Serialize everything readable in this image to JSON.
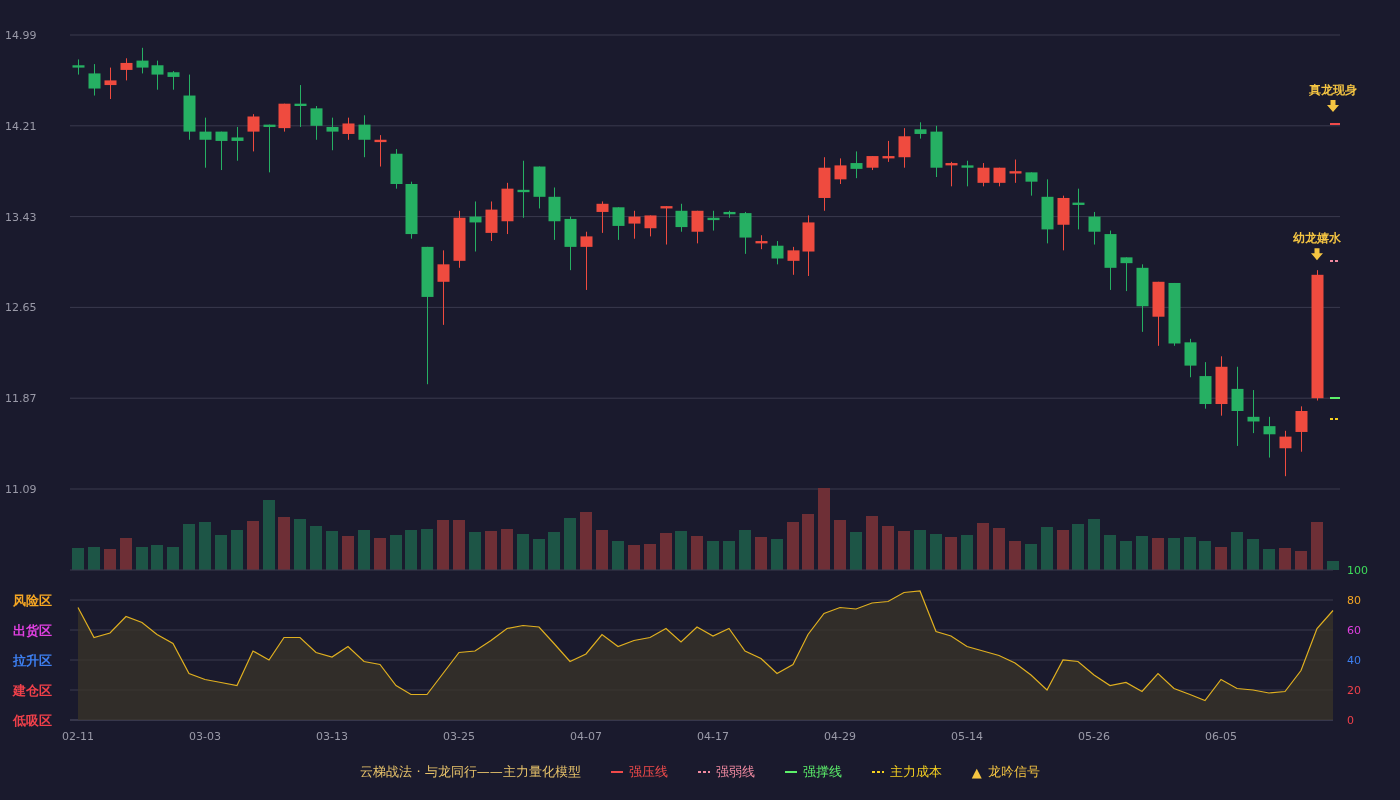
{
  "price_chart": {
    "chart_data": {
      "type": "candlestick",
      "ylim": [
        11.09,
        14.99
      ],
      "yticks": [
        14.99,
        14.21,
        13.43,
        12.65,
        11.87,
        11.09
      ],
      "grid": true,
      "categories": [
        null,
        null,
        null,
        null,
        null,
        null,
        null,
        null,
        null,
        null,
        null,
        null,
        null,
        null,
        null,
        null,
        null,
        null,
        null,
        null,
        null,
        null,
        null,
        null,
        null,
        null,
        null,
        null,
        null,
        null,
        null,
        null,
        null,
        null,
        null,
        null,
        null,
        null,
        null,
        null,
        null,
        null,
        null,
        null,
        null,
        null,
        null,
        null,
        null,
        null,
        null,
        null,
        null,
        null,
        null,
        null,
        null,
        null,
        null,
        null,
        null,
        null,
        null,
        null,
        null,
        null,
        null,
        null,
        null,
        null,
        null,
        null,
        null,
        null,
        null,
        null,
        null,
        null,
        null,
        null
      ],
      "ohlc": [
        [
          14.73,
          14.78,
          14.65,
          14.71
        ],
        [
          14.66,
          14.74,
          14.47,
          14.53
        ],
        [
          14.56,
          14.71,
          14.44,
          14.6
        ],
        [
          14.69,
          14.79,
          14.6,
          14.75
        ],
        [
          14.77,
          14.88,
          14.66,
          14.71
        ],
        [
          14.73,
          14.77,
          14.52,
          14.65
        ],
        [
          14.67,
          14.68,
          14.52,
          14.63
        ],
        [
          14.47,
          14.65,
          14.09,
          14.16
        ],
        [
          14.16,
          14.28,
          13.85,
          14.09
        ],
        [
          14.16,
          14.16,
          13.83,
          14.08
        ],
        [
          14.11,
          14.2,
          13.91,
          14.08
        ],
        [
          14.16,
          14.31,
          13.99,
          14.29
        ],
        [
          14.22,
          14.22,
          13.81,
          14.2
        ],
        [
          14.19,
          14.4,
          14.16,
          14.4
        ],
        [
          14.4,
          14.56,
          14.2,
          14.38
        ],
        [
          14.36,
          14.38,
          14.09,
          14.21
        ],
        [
          14.2,
          14.28,
          14.0,
          14.16
        ],
        [
          14.14,
          14.28,
          14.09,
          14.23
        ],
        [
          14.22,
          14.3,
          13.94,
          14.09
        ],
        [
          14.07,
          14.13,
          13.86,
          14.09
        ],
        [
          13.97,
          14.01,
          13.67,
          13.71
        ],
        [
          13.71,
          13.73,
          13.24,
          13.28
        ],
        [
          13.17,
          13.17,
          11.99,
          12.74
        ],
        [
          12.87,
          13.14,
          12.5,
          13.02
        ],
        [
          13.05,
          13.48,
          12.99,
          13.42
        ],
        [
          13.43,
          13.56,
          13.13,
          13.38
        ],
        [
          13.29,
          13.56,
          13.22,
          13.49
        ],
        [
          13.39,
          13.72,
          13.28,
          13.67
        ],
        [
          13.66,
          13.91,
          13.42,
          13.64
        ],
        [
          13.86,
          13.86,
          13.5,
          13.6
        ],
        [
          13.6,
          13.68,
          13.23,
          13.39
        ],
        [
          13.41,
          13.43,
          12.97,
          13.17
        ],
        [
          13.17,
          13.3,
          12.8,
          13.26
        ],
        [
          13.47,
          13.56,
          13.29,
          13.54
        ],
        [
          13.51,
          13.51,
          13.23,
          13.35
        ],
        [
          13.37,
          13.48,
          13.24,
          13.43
        ],
        [
          13.33,
          13.44,
          13.26,
          13.44
        ],
        [
          13.5,
          13.52,
          13.19,
          13.52
        ],
        [
          13.48,
          13.54,
          13.3,
          13.34
        ],
        [
          13.3,
          13.48,
          13.2,
          13.48
        ],
        [
          13.42,
          13.48,
          13.31,
          13.4
        ],
        [
          13.47,
          13.48,
          13.42,
          13.45
        ],
        [
          13.46,
          13.47,
          13.11,
          13.25
        ],
        [
          13.2,
          13.27,
          13.15,
          13.22
        ],
        [
          13.18,
          13.22,
          13.02,
          13.07
        ],
        [
          13.05,
          13.17,
          12.93,
          13.14
        ],
        [
          13.13,
          13.44,
          12.92,
          13.38
        ],
        [
          13.59,
          13.94,
          13.48,
          13.85
        ],
        [
          13.75,
          13.93,
          13.71,
          13.87
        ],
        [
          13.89,
          13.99,
          13.76,
          13.84
        ],
        [
          13.85,
          13.95,
          13.83,
          13.95
        ],
        [
          13.93,
          14.08,
          13.9,
          13.95
        ],
        [
          13.94,
          14.19,
          13.85,
          14.12
        ],
        [
          14.18,
          14.24,
          14.1,
          14.14
        ],
        [
          14.16,
          14.21,
          13.77,
          13.85
        ],
        [
          13.87,
          13.9,
          13.69,
          13.89
        ],
        [
          13.87,
          13.91,
          13.69,
          13.85
        ],
        [
          13.72,
          13.89,
          13.69,
          13.85
        ],
        [
          13.72,
          13.85,
          13.69,
          13.85
        ],
        [
          13.8,
          13.92,
          13.72,
          13.82
        ],
        [
          13.81,
          13.81,
          13.61,
          13.73
        ],
        [
          13.6,
          13.75,
          13.2,
          13.32
        ],
        [
          13.36,
          13.61,
          13.14,
          13.59
        ],
        [
          13.55,
          13.67,
          13.32,
          13.53
        ],
        [
          13.43,
          13.47,
          13.19,
          13.3
        ],
        [
          13.28,
          13.31,
          12.8,
          12.99
        ],
        [
          13.08,
          13.08,
          12.79,
          13.03
        ],
        [
          12.99,
          13.02,
          12.44,
          12.66
        ],
        [
          12.57,
          12.87,
          12.32,
          12.87
        ],
        [
          12.86,
          12.86,
          12.32,
          12.34
        ],
        [
          12.35,
          12.38,
          12.05,
          12.15
        ],
        [
          12.06,
          12.18,
          11.78,
          11.82
        ],
        [
          11.82,
          12.23,
          11.72,
          12.14
        ],
        [
          11.95,
          12.14,
          11.46,
          11.76
        ],
        [
          11.71,
          11.94,
          11.57,
          11.67
        ],
        [
          11.63,
          11.71,
          11.36,
          11.56
        ],
        [
          11.44,
          11.59,
          11.2,
          11.54
        ],
        [
          11.58,
          11.8,
          11.41,
          11.76
        ],
        [
          11.87,
          12.97,
          11.85,
          12.93
        ],
        null
      ],
      "annotations": [
        {
          "text": "真龙现身"
        },
        {
          "text": "幼龙嬉水"
        }
      ]
    }
  },
  "indicator_chart": {
    "chart_data": {
      "type": "area",
      "ylim": [
        0,
        100
      ],
      "grid": true,
      "yticks": [
        {
          "value": 100,
          "label": "100"
        },
        {
          "value": 80,
          "label": "80"
        },
        {
          "value": 60,
          "label": "60"
        },
        {
          "value": 40,
          "label": "40"
        },
        {
          "value": 20,
          "label": "20"
        },
        {
          "value": 0,
          "label": "0"
        }
      ],
      "categories": [
        "02-11",
        null,
        null,
        null,
        null,
        null,
        null,
        null,
        "03-03",
        null,
        null,
        null,
        null,
        null,
        null,
        null,
        "03-13",
        null,
        null,
        null,
        null,
        null,
        null,
        null,
        "03-25",
        null,
        null,
        null,
        null,
        null,
        null,
        null,
        "04-07",
        null,
        null,
        null,
        null,
        null,
        null,
        null,
        "04-17",
        null,
        null,
        null,
        null,
        null,
        null,
        null,
        "04-29",
        null,
        null,
        null,
        null,
        null,
        null,
        null,
        "05-14",
        null,
        null,
        null,
        null,
        null,
        null,
        null,
        "05-26",
        null,
        null,
        null,
        null,
        null,
        null,
        null,
        "06-05",
        null,
        null,
        null,
        null,
        null,
        null,
        null
      ],
      "series": [
        {
          "color": "#e0b020",
          "values": [
            75,
            55,
            58,
            69,
            65,
            57,
            51,
            31,
            27,
            25,
            23,
            46,
            40,
            55,
            55,
            45,
            42,
            49,
            39,
            37,
            23,
            17,
            17,
            31,
            45,
            46,
            53,
            61,
            63,
            62,
            51,
            39,
            44,
            57,
            49,
            53,
            55,
            61,
            52,
            62,
            56,
            61,
            46,
            41,
            31,
            37,
            57,
            71,
            75,
            74,
            78,
            79,
            85,
            86,
            59,
            56,
            49,
            46,
            43,
            38,
            30,
            20,
            40,
            39,
            30,
            23,
            25,
            19,
            31,
            21,
            17,
            13,
            27,
            21,
            20,
            18,
            19,
            33,
            61,
            73
          ]
        }
      ]
    },
    "zones": [
      {
        "label": "风险区",
        "color": "#f5a623"
      },
      {
        "label": "出货区",
        "color": "#e040e0"
      },
      {
        "label": "拉升区",
        "color": "#3d7ff0"
      },
      {
        "label": "建仓区",
        "color": "#f0404a"
      },
      {
        "label": "低吸区",
        "color": "#f0404a"
      }
    ]
  },
  "legend": {
    "title": "云梯战法 · 与龙同行——主力量化模型",
    "items": [
      {
        "kind": "line",
        "label": "强压线",
        "color": "#f04a4a",
        "dashed": false
      },
      {
        "kind": "line",
        "label": "强弱线",
        "color": "#f08aa0",
        "dashed": true
      },
      {
        "kind": "line",
        "label": "强撑线",
        "color": "#5cf06a",
        "dashed": false
      },
      {
        "kind": "line",
        "label": "主力成本",
        "color": "#f5d020",
        "dashed": true
      },
      {
        "kind": "marker",
        "symbol": "▲",
        "label": "龙吟信号",
        "color": "#f5c542"
      }
    ]
  }
}
